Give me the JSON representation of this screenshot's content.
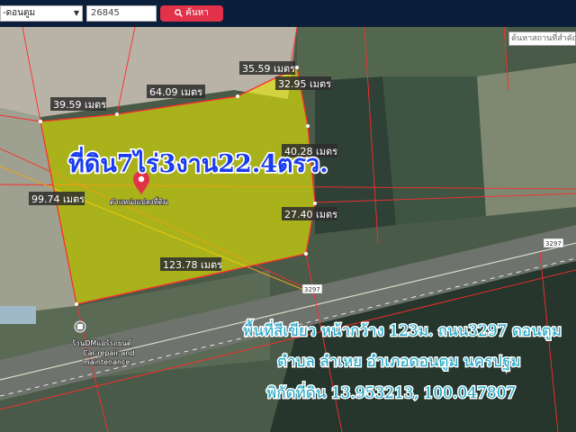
{
  "search": {
    "district_select": "-ดอนตูม",
    "parcel_input": "26845",
    "button_label": "ค้นหา"
  },
  "map": {
    "place_search_placeholder": "ค้นหาสถานที่สำคัญ",
    "parcel_fill_color": "#e3e600",
    "boundary_color": "#ff2b2b",
    "dimensions": {
      "d1": "35.59 เมตร",
      "d2": "32.95 เมตร",
      "d3": "64.09 เมตร",
      "d4": "39.59 เมตร",
      "d5": "40.28 เมตร",
      "d6": "99.74 เมตร",
      "d7": "27.40 เมตร",
      "d8": "123.78 เมตร"
    },
    "area_title": "ที่ดิน7ไร่3งาน22.4ตรว.",
    "pin_label": "ตำแหน่งแปลงที่ดิน",
    "road_label_1": "3297",
    "road_label_2": "3297",
    "poi_name": "ร้านDMแอร์รถยนต์",
    "poi_sub1": "Car repair and",
    "poi_sub2": "maintenance",
    "info_line1": "พื้นที่สีเขียว หน้ากว้าง 123ม. ถนน3297 ดอนตูม",
    "info_line2": "ตำบล ลำเหย อำเภอดอนตูม นครปฐม",
    "info_line3": "พิกัดที่ดิน 13.953213, 100.047807"
  }
}
